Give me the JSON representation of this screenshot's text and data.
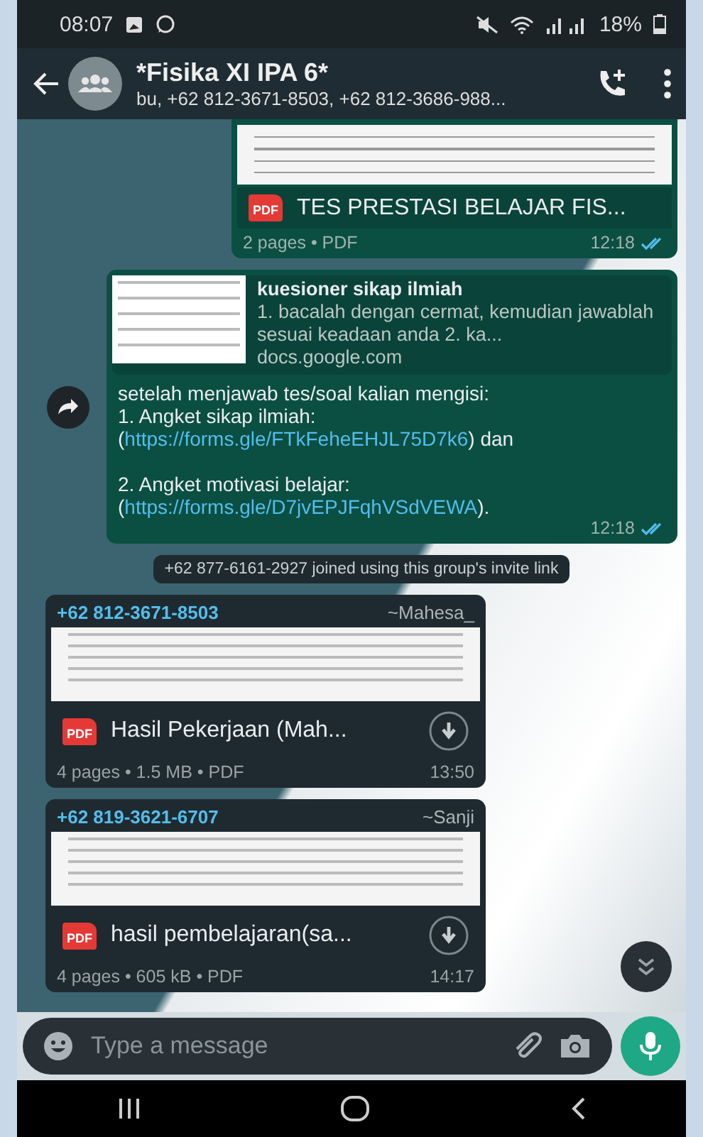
{
  "status_bar": {
    "time": "08:07",
    "battery": "18%"
  },
  "header": {
    "title": "*Fisika XI IPA 6*",
    "subtitle": "bu, +62 812-3671-8503, +62 812-3686-988..."
  },
  "messages": [
    {
      "kind": "document_out",
      "badge": "PDF",
      "file_name": "TES PRESTASI BELAJAR FIS...",
      "meta": "2 pages • PDF",
      "time": "12:18",
      "read": true
    },
    {
      "kind": "link_out",
      "forwarded": true,
      "preview": {
        "title": "kuesioner sikap ilmiah",
        "description": "1. bacalah dengan cermat, kemudian jawablah sesuai keadaan anda 2. ka...",
        "domain": "docs.google.com"
      },
      "body": [
        {
          "kind": "text",
          "text": "setelah menjawab tes/soal kalian mengisi:\n1. Angket sikap ilmiah: ("
        },
        {
          "kind": "link",
          "text": "https://forms.gle/FTkFeheEHJL75D7k6"
        },
        {
          "kind": "text",
          "text": ") dan\n\n2. Angket motivasi belajar: ("
        },
        {
          "kind": "link",
          "text": "https://forms.gle/D7jvEPJFqhVSdVEWA"
        },
        {
          "kind": "text",
          "text": ")."
        }
      ],
      "time": "12:18",
      "read": true
    },
    {
      "kind": "system",
      "text": "+62 877-6161-2927 joined using this group's invite link"
    },
    {
      "kind": "document_in",
      "sender": "+62 812-3671-8503",
      "sender_name": "~Mahesa_",
      "badge": "PDF",
      "file_name": "Hasil Pekerjaan (Mah...",
      "meta": "4 pages • 1.5 MB • PDF",
      "time": "13:50"
    },
    {
      "kind": "document_in",
      "sender": "+62 819-3621-6707",
      "sender_name": "~Sanji",
      "badge": "PDF",
      "file_name": "hasil pembelajaran(sa...",
      "meta": "4 pages • 605 kB • PDF",
      "time": "14:17"
    }
  ],
  "composer": {
    "placeholder": "Type a message"
  }
}
